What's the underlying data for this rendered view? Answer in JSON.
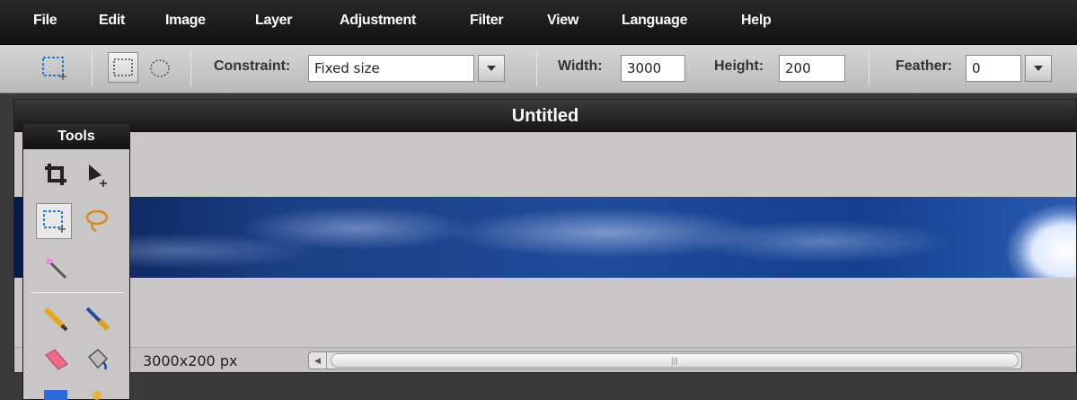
{
  "menu": [
    "File",
    "Edit",
    "Image",
    "Layer",
    "Adjustment",
    "Filter",
    "View",
    "Language",
    "Help"
  ],
  "options": {
    "constraint_label": "Constraint:",
    "constraint_value": "Fixed size",
    "width_label": "Width:",
    "width_value": "3000",
    "height_label": "Height:",
    "height_value": "200",
    "feather_label": "Feather:",
    "feather_value": "0"
  },
  "document": {
    "title": "Untitled",
    "size_text": "3000x200 px"
  },
  "tools_panel": {
    "title": "Tools",
    "tools": [
      "crop-icon",
      "move-icon",
      "marquee-select-icon",
      "lasso-icon",
      "magic-wand-icon",
      "pencil-icon",
      "brush-icon",
      "eraser-icon",
      "paint-bucket-icon"
    ]
  },
  "colors": {
    "menubar": "#111111",
    "optionsbar": "#c8c8c8",
    "canvas_bg": "#c9c7c8",
    "sky": "#1e4b9a"
  }
}
